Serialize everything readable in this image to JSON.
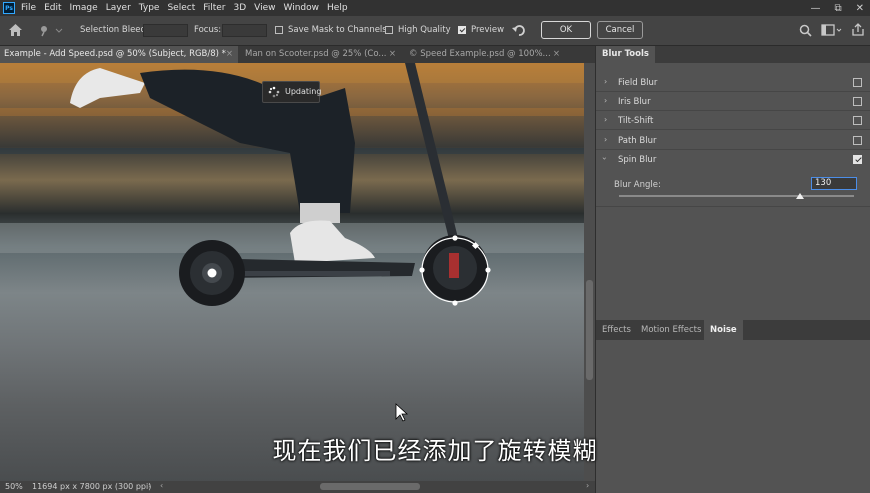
{
  "app": {
    "logo": "Ps"
  },
  "menu": [
    "File",
    "Edit",
    "Image",
    "Layer",
    "Type",
    "Select",
    "Filter",
    "3D",
    "View",
    "Window",
    "Help"
  ],
  "window_controls": [
    "—",
    "⧉",
    "✕"
  ],
  "options": {
    "selection_bleed_label": "Selection Bleed:",
    "focus_label": "Focus:",
    "save_mask_label": "Save Mask to Channels",
    "high_quality_label": "High Quality",
    "preview_label": "Preview",
    "ok_label": "OK",
    "cancel_label": "Cancel",
    "save_mask_checked": false,
    "high_quality_checked": false,
    "preview_checked": true
  },
  "tabs": [
    {
      "label": "Example - Add Speed.psd @ 50% (Subject, RGB/8) *",
      "active": true
    },
    {
      "label": "Man on Scooter.psd @ 25% (Co...",
      "active": false
    },
    {
      "label": "© Speed Example.psd @ 100%...",
      "active": false
    }
  ],
  "canvas": {
    "tooltip": "Updating"
  },
  "status": {
    "zoom": "50%",
    "doc_info": "11694 px x 7800 px (300 ppi)"
  },
  "panel": {
    "title": "Blur Tools",
    "blurs": [
      {
        "label": "Field Blur",
        "checked": false
      },
      {
        "label": "Iris Blur",
        "checked": false
      },
      {
        "label": "Tilt-Shift",
        "checked": false
      },
      {
        "label": "Path Blur",
        "checked": false
      },
      {
        "label": "Spin Blur",
        "checked": true
      }
    ],
    "blur_angle_label": "Blur Angle:",
    "blur_angle_value": "130",
    "lower_tabs": [
      {
        "label": "Effects",
        "active": false
      },
      {
        "label": "Motion Effects",
        "active": false
      },
      {
        "label": "Noise",
        "active": true
      }
    ]
  },
  "subtitle": "现在我们已经添加了旋转模糊"
}
